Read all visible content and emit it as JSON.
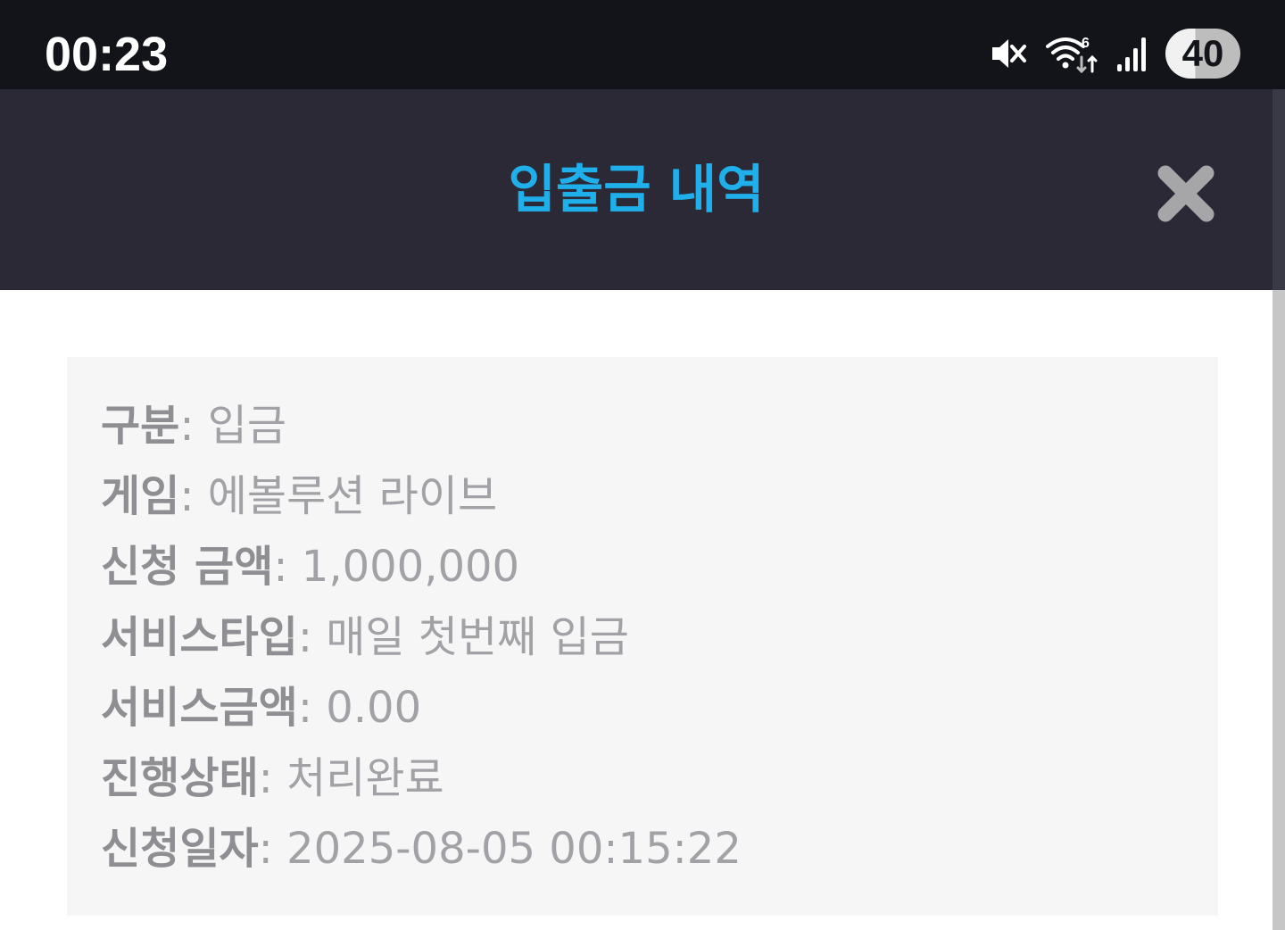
{
  "status_bar": {
    "time": "00:23",
    "battery": "40",
    "icons": [
      "mute-icon",
      "wifi-6-icon",
      "signal-icon",
      "battery-icon"
    ]
  },
  "header": {
    "title": "입출금 내역",
    "title_color": "#1fb0ec",
    "close_icon": "close-icon"
  },
  "details": {
    "separator": ": ",
    "rows": [
      {
        "label": "구분",
        "value": "입금"
      },
      {
        "label": "게임",
        "value": "에볼루션 라이브"
      },
      {
        "label": "신청 금액",
        "value": "1,000,000"
      },
      {
        "label": "서비스타입",
        "value": "매일 첫번째 입금"
      },
      {
        "label": "서비스금액",
        "value": "0.00"
      },
      {
        "label": "진행상태",
        "value": "처리완료"
      },
      {
        "label": "신청일자",
        "value": "2025-08-05 00:15:22"
      }
    ]
  }
}
